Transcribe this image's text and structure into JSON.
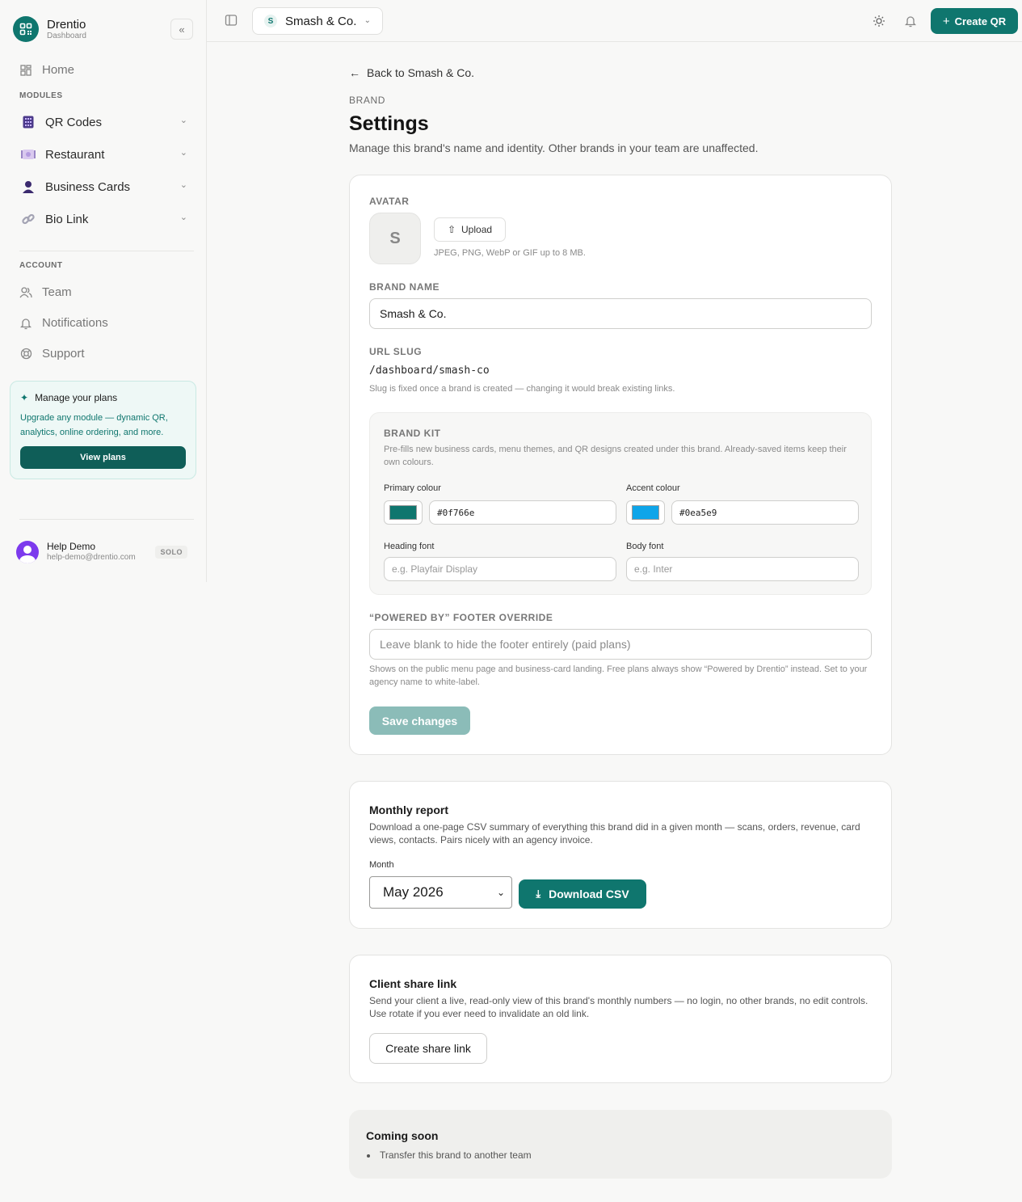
{
  "app": {
    "name": "Drentio",
    "subtitle": "Dashboard"
  },
  "sidebar": {
    "home_label": "Home",
    "modules_label": "MODULES",
    "modules": [
      {
        "label": "QR Codes",
        "icon": "qr-grid-icon"
      },
      {
        "label": "Restaurant",
        "icon": "plate-icon"
      },
      {
        "label": "Business Cards",
        "icon": "person-icon"
      },
      {
        "label": "Bio Link",
        "icon": "link-icon"
      }
    ],
    "account_label": "ACCOUNT",
    "account_items": [
      {
        "label": "Team",
        "icon": "users-icon"
      },
      {
        "label": "Notifications",
        "icon": "bell-icon"
      },
      {
        "label": "Support",
        "icon": "lifebuoy-icon"
      }
    ],
    "plan_card": {
      "title": "Manage your plans",
      "description": "Upgrade any module — dynamic QR, analytics, online ordering, and more.",
      "button": "View plans"
    },
    "user": {
      "name": "Help Demo",
      "email": "help-demo@drentio.com",
      "badge": "SOLO"
    }
  },
  "topbar": {
    "brand_initial": "S",
    "brand_name": "Smash & Co.",
    "create_label": "Create QR"
  },
  "page": {
    "back_label": "Back to Smash & Co.",
    "eyebrow": "BRAND",
    "title": "Settings",
    "description": "Manage this brand's name and identity. Other brands in your team are unaffected."
  },
  "settings_card": {
    "avatar_label": "AVATAR",
    "avatar_initial": "S",
    "upload_label": "Upload",
    "upload_hint": "JPEG, PNG, WebP or GIF up to 8 MB.",
    "brand_name_label": "BRAND NAME",
    "brand_name_value": "Smash & Co.",
    "slug_label": "URL SLUG",
    "slug_value": "/dashboard/smash-co",
    "slug_hint": "Slug is fixed once a brand is created — changing it would break existing links.",
    "brand_kit": {
      "title": "BRAND KIT",
      "description": "Pre-fills new business cards, menu themes, and QR designs created under this brand. Already-saved items keep their own colours.",
      "primary_label": "Primary colour",
      "primary_value": "#0f766e",
      "accent_label": "Accent colour",
      "accent_value": "#0ea5e9",
      "heading_font_label": "Heading font",
      "heading_font_placeholder": "e.g. Playfair Display",
      "body_font_label": "Body font",
      "body_font_placeholder": "e.g. Inter"
    },
    "footer_label": "“POWERED BY” FOOTER OVERRIDE",
    "footer_placeholder": "Leave blank to hide the footer entirely (paid plans)",
    "footer_hint": "Shows on the public menu page and business-card landing. Free plans always show “Powered by Drentio” instead. Set to your agency name to white-label.",
    "save_label": "Save changes"
  },
  "report_card": {
    "title": "Monthly report",
    "description": "Download a one-page CSV summary of everything this brand did in a given month — scans, orders, revenue, card views, contacts. Pairs nicely with an agency invoice.",
    "month_label": "Month",
    "month_value": "May 2026",
    "download_label": "Download CSV"
  },
  "share_card": {
    "title": "Client share link",
    "description": "Send your client a live, read-only view of this brand's monthly numbers — no login, no other brands, no edit controls. Use rotate if you ever need to invalidate an old link.",
    "button": "Create share link"
  },
  "coming_soon": {
    "title": "Coming soon",
    "items": [
      "Transfer this brand to another team"
    ]
  },
  "colors": {
    "brand": "#0f766e",
    "accent": "#0ea5e9",
    "save_disabled": "#8bbcb8"
  }
}
